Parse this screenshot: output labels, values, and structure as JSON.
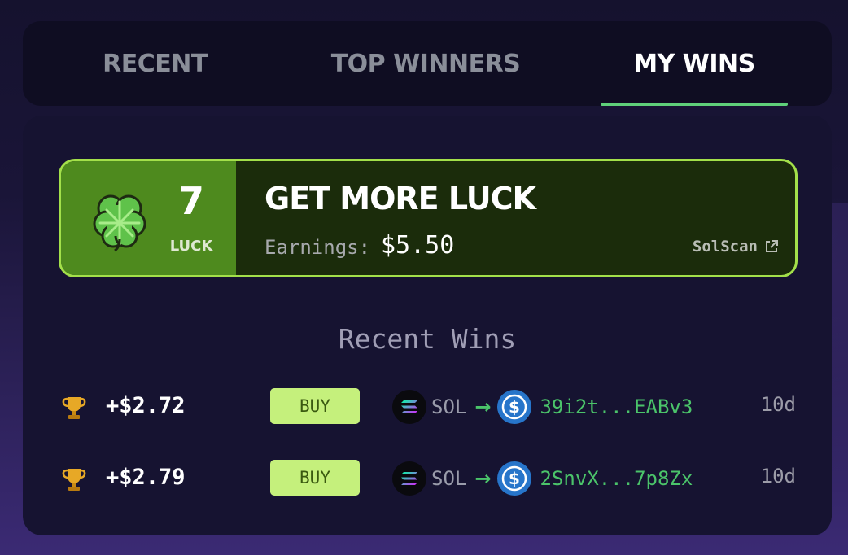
{
  "tabs": [
    {
      "label": "RECENT",
      "active": false
    },
    {
      "label": "TOP WINNERS",
      "active": false
    },
    {
      "label": "MY WINS",
      "active": true
    }
  ],
  "luck_card": {
    "count": "7",
    "count_label": "LUCK",
    "title": "GET MORE LUCK",
    "earnings_label": "Earnings:",
    "earnings_value": "$5.50",
    "link_label": "SolScan",
    "icon": "four-leaf-clover-icon"
  },
  "recent_wins": {
    "title": "Recent Wins",
    "rows": [
      {
        "amount": "+$2.72",
        "buy_label": "BUY",
        "from_token": "SOL",
        "tx": "39i2t...EABv3",
        "age": "10d"
      },
      {
        "amount": "+$2.79",
        "buy_label": "BUY",
        "from_token": "SOL",
        "tx": "2SnvX...7p8Zx",
        "age": "10d"
      }
    ]
  },
  "colors": {
    "accent_green": "#4bc46a",
    "card_border": "#a3e04a",
    "buy_button": "#c5f07c"
  }
}
